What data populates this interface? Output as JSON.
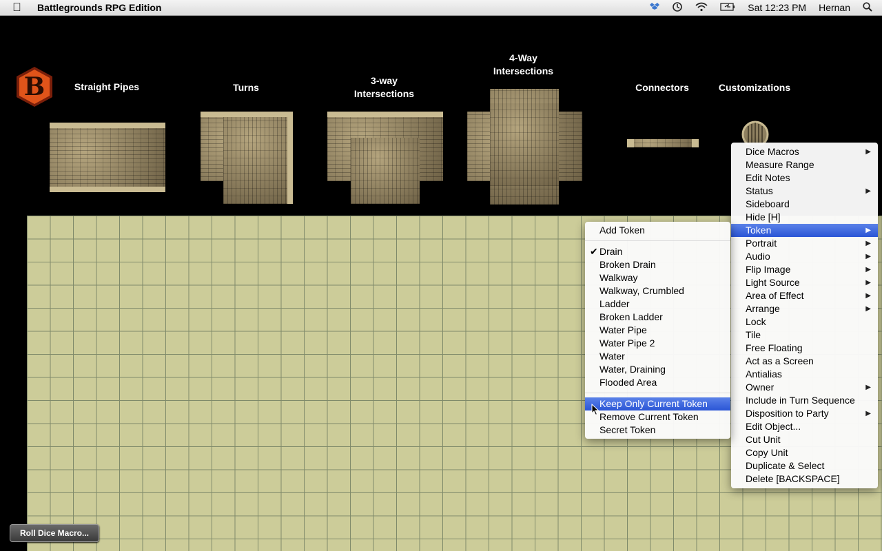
{
  "menubar": {
    "app_name": "Battlegrounds RPG Edition",
    "clock": "Sat 12:23 PM",
    "user": "Hernan"
  },
  "categories": {
    "straight": "Straight Pipes",
    "turns": "Turns",
    "threeway": "3-way\nIntersections",
    "fourway": "4-Way\nIntersections",
    "connectors": "Connectors",
    "customizations": "Customizations"
  },
  "roll_dice": "Roll Dice Macro...",
  "main_menu": {
    "items": [
      {
        "label": "Dice Macros",
        "submenu": true
      },
      {
        "label": "Measure Range",
        "submenu": false
      },
      {
        "label": "Edit Notes",
        "submenu": false
      },
      {
        "label": "Status",
        "submenu": true
      },
      {
        "label": "Sideboard",
        "submenu": false
      },
      {
        "label": "Hide [H]",
        "submenu": false
      },
      {
        "label": "Token",
        "submenu": true,
        "highlighted": true
      },
      {
        "label": "Portrait",
        "submenu": true
      },
      {
        "label": "Audio",
        "submenu": true
      },
      {
        "label": "Flip Image",
        "submenu": true
      },
      {
        "label": "Light Source",
        "submenu": true
      },
      {
        "label": "Area of Effect",
        "submenu": true
      },
      {
        "label": "Arrange",
        "submenu": true
      },
      {
        "label": "Lock",
        "submenu": false
      },
      {
        "label": "Tile",
        "submenu": false
      },
      {
        "label": "Free Floating",
        "submenu": false
      },
      {
        "label": "Act as a Screen",
        "submenu": false
      },
      {
        "label": "Antialias",
        "submenu": false
      },
      {
        "label": "Owner",
        "submenu": true
      },
      {
        "label": "Include in Turn Sequence",
        "submenu": false
      },
      {
        "label": "Disposition to Party",
        "submenu": true
      },
      {
        "label": "Edit Object...",
        "submenu": false
      },
      {
        "label": "Cut Unit",
        "submenu": false
      },
      {
        "label": "Copy Unit",
        "submenu": false
      },
      {
        "label": "Duplicate & Select",
        "submenu": false
      },
      {
        "label": "Delete [BACKSPACE]",
        "submenu": false
      }
    ]
  },
  "token_menu": {
    "add": "Add Token",
    "tokens": [
      {
        "label": "Drain",
        "checked": true
      },
      {
        "label": "Broken Drain"
      },
      {
        "label": "Walkway"
      },
      {
        "label": "Walkway, Crumbled"
      },
      {
        "label": "Ladder"
      },
      {
        "label": "Broken Ladder"
      },
      {
        "label": "Water Pipe"
      },
      {
        "label": "Water Pipe 2"
      },
      {
        "label": "Water"
      },
      {
        "label": "Water, Draining"
      },
      {
        "label": "Flooded Area"
      }
    ],
    "actions": [
      {
        "label": "Keep Only Current Token",
        "highlighted": true
      },
      {
        "label": "Remove Current Token"
      },
      {
        "label": "Secret Token"
      }
    ]
  },
  "colors": {
    "highlight": "#3a63dd",
    "grid_fill": "#cccc99",
    "logo": "#e0541a"
  }
}
